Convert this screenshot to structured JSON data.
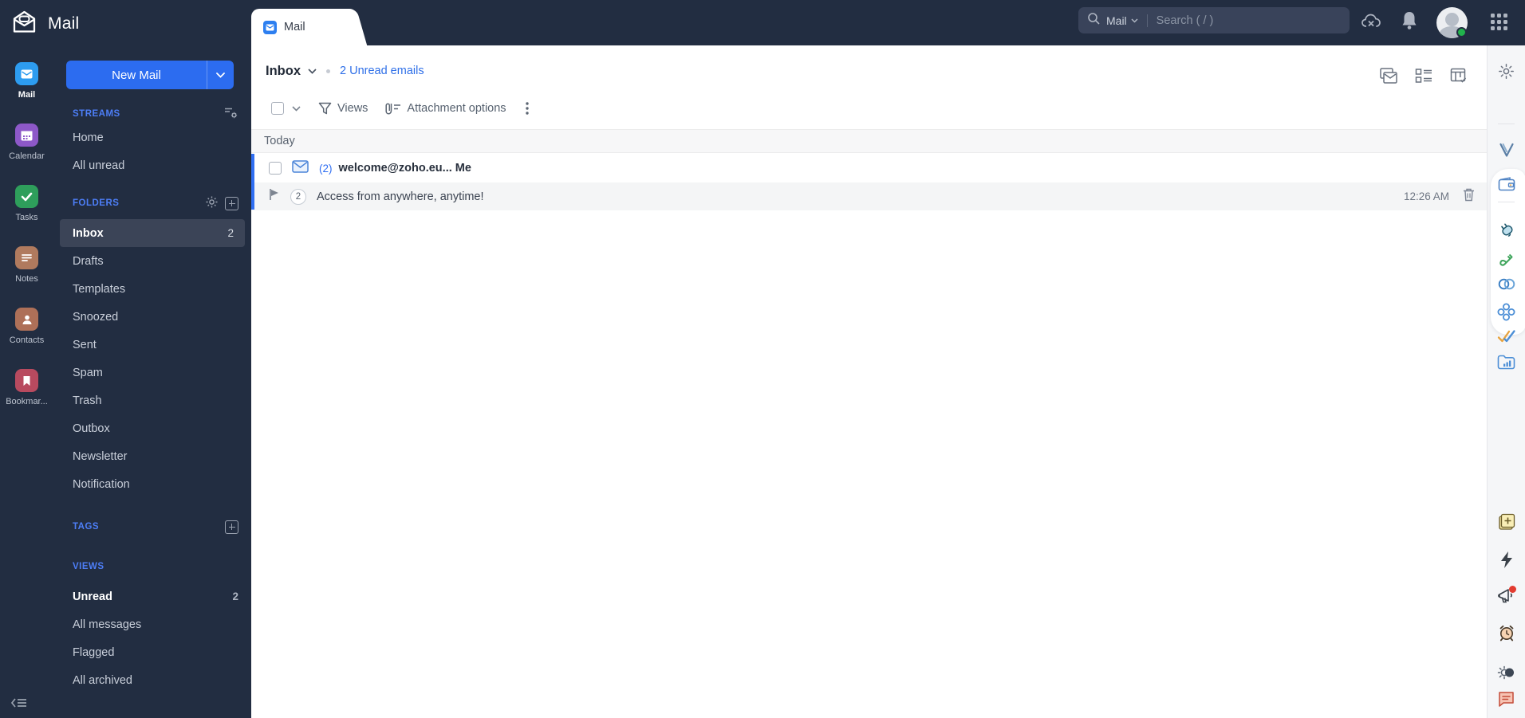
{
  "colors": {
    "dark_bg": "#222d41",
    "accent_blue": "#2c6cf0",
    "link_blue": "#2e6fe8",
    "selected_row_bg": "#3b4457",
    "unread_bar_blue": "#2f6ef2",
    "section_title_blue": "#4d7ef7",
    "status_green": "#21b24c",
    "rail_bg": "#f5f6f8"
  },
  "header": {
    "app_title": "Mail",
    "tab_label": "Mail",
    "search_scope": "Mail",
    "search_placeholder": "Search ( / )"
  },
  "app_rail": {
    "items": [
      {
        "label": "Mail"
      },
      {
        "label": "Calendar"
      },
      {
        "label": "Tasks"
      },
      {
        "label": "Notes"
      },
      {
        "label": "Contacts"
      },
      {
        "label": "Bookmar..."
      }
    ]
  },
  "sidebar": {
    "new_mail_label": "New Mail",
    "streams": {
      "title": "STREAMS",
      "items": [
        {
          "label": "Home"
        },
        {
          "label": "All unread"
        }
      ]
    },
    "folders": {
      "title": "FOLDERS",
      "items": [
        {
          "label": "Inbox",
          "count": "2"
        },
        {
          "label": "Drafts"
        },
        {
          "label": "Templates"
        },
        {
          "label": "Snoozed"
        },
        {
          "label": "Sent"
        },
        {
          "label": "Spam"
        },
        {
          "label": "Trash"
        },
        {
          "label": "Outbox"
        },
        {
          "label": "Newsletter"
        },
        {
          "label": "Notification"
        }
      ]
    },
    "tags": {
      "title": "TAGS"
    },
    "views": {
      "title": "VIEWS",
      "items": [
        {
          "label": "Unread",
          "count": "2"
        },
        {
          "label": "All messages"
        },
        {
          "label": "Flagged"
        },
        {
          "label": "All archived"
        }
      ]
    }
  },
  "main": {
    "folder_title": "Inbox",
    "unread_summary": "2 Unread emails",
    "toolbar": {
      "views_label": "Views",
      "attachment_label": "Attachment options"
    },
    "group_header": "Today",
    "email": {
      "unread_prefix": "(2)",
      "sender": "welcome@zoho.eu... Me",
      "thread_count": "2",
      "subject": "Access from anywhere, anytime!",
      "time": "12:26 AM"
    }
  }
}
